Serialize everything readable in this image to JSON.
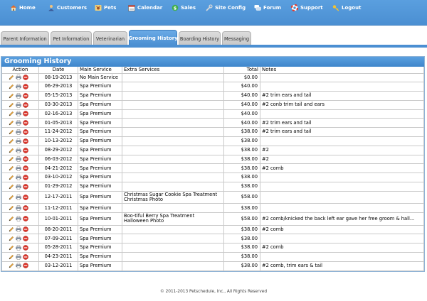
{
  "nav": {
    "items": [
      {
        "label": "Home",
        "icon": "home-icon"
      },
      {
        "label": "Customers",
        "icon": "customers-icon"
      },
      {
        "label": "Pets",
        "icon": "pets-icon"
      },
      {
        "label": "Calendar",
        "icon": "calendar-icon"
      },
      {
        "label": "Sales",
        "icon": "sales-icon"
      },
      {
        "label": "Site Config",
        "icon": "wrench-icon"
      },
      {
        "label": "Forum",
        "icon": "forum-icon"
      },
      {
        "label": "Support",
        "icon": "lifebuoy-icon"
      },
      {
        "label": "Logout",
        "icon": "key-icon"
      }
    ]
  },
  "tabs": [
    {
      "label": "Parent Information"
    },
    {
      "label": "Pet Information"
    },
    {
      "label": "Veterinarian"
    },
    {
      "label": "Grooming History",
      "active": true
    },
    {
      "label": "Boarding History"
    },
    {
      "label": "Messaging"
    }
  ],
  "panel": {
    "title": "Grooming History",
    "columns": {
      "action": "Action",
      "date": "Date",
      "main_service": "Main Service",
      "extra_services": "Extra Services",
      "total": "Total",
      "notes": "Notes"
    },
    "action_icons": [
      "edit-pencil-icon",
      "print-icon",
      "delete-icon"
    ],
    "rows": [
      {
        "date": "08-19-2013",
        "main": "No Main Service",
        "extra": "",
        "total": "$0.00",
        "notes": ""
      },
      {
        "date": "06-29-2013",
        "main": "Spa Premium",
        "extra": "",
        "total": "$40.00",
        "notes": ""
      },
      {
        "date": "05-15-2013",
        "main": "Spa Premium",
        "extra": "",
        "total": "$40.00",
        "notes": "#2 trim ears and tail"
      },
      {
        "date": "03-30-2013",
        "main": "Spa Premium",
        "extra": "",
        "total": "$40.00",
        "notes": "#2 conb trim tail and ears"
      },
      {
        "date": "02-16-2013",
        "main": "Spa Premium",
        "extra": "",
        "total": "$40.00",
        "notes": ""
      },
      {
        "date": "01-05-2013",
        "main": "Spa Premium",
        "extra": "",
        "total": "$40.00",
        "notes": "#2 trim ears and tail"
      },
      {
        "date": "11-24-2012",
        "main": "Spa Premium",
        "extra": "",
        "total": "$38.00",
        "notes": "#2 trim ears and tail"
      },
      {
        "date": "10-13-2012",
        "main": "Spa Premium",
        "extra": "",
        "total": "$38.00",
        "notes": ""
      },
      {
        "date": "08-29-2012",
        "main": "Spa Premium",
        "extra": "",
        "total": "$38.00",
        "notes": "#2"
      },
      {
        "date": "06-03-2012",
        "main": "Spa Premium",
        "extra": "",
        "total": "$38.00",
        "notes": "#2"
      },
      {
        "date": "04-21-2012",
        "main": "Spa Premium",
        "extra": "",
        "total": "$38.00",
        "notes": "#2 comb"
      },
      {
        "date": "03-10-2012",
        "main": "Spa Premium",
        "extra": "",
        "total": "$38.00",
        "notes": ""
      },
      {
        "date": "01-29-2012",
        "main": "Spa Premium",
        "extra": "",
        "total": "$38.00",
        "notes": ""
      },
      {
        "date": "12-17-2011",
        "main": "Spa Premium",
        "extra": "Christmas Sugar Cookie Spa Treatment",
        "extra2": "Christmas Photo",
        "total": "$58.00",
        "notes": ""
      },
      {
        "date": "11-12-2011",
        "main": "Spa Premium",
        "extra": "",
        "total": "$38.00",
        "notes": ""
      },
      {
        "date": "10-01-2011",
        "main": "Spa Premium",
        "extra": "Boo-tiful Berry Spa Treatment",
        "extra2": "Halloween Photo",
        "total": "$58.00",
        "notes": "#2 comb/knicked the back left ear gave her free groom & hall..."
      },
      {
        "date": "08-20-2011",
        "main": "Spa Premium",
        "extra": "",
        "total": "$38.00",
        "notes": "#2 comb"
      },
      {
        "date": "07-09-2011",
        "main": "Spa Premium",
        "extra": "",
        "total": "$38.00",
        "notes": ""
      },
      {
        "date": "05-28-2011",
        "main": "Spa Premium",
        "extra": "",
        "total": "$38.00",
        "notes": "#2 comb"
      },
      {
        "date": "04-23-2011",
        "main": "Spa Premium",
        "extra": "",
        "total": "$38.00",
        "notes": ""
      },
      {
        "date": "03-12-2011",
        "main": "Spa Premium",
        "extra": "",
        "total": "$38.00",
        "notes": "#2 comb, trim ears & tail"
      }
    ]
  },
  "footer": {
    "text": "© 2011-2013 Petschedule, Inc., All Rights Reserved"
  },
  "colors": {
    "nav_blue": "#4b8fd2",
    "panel_title": "#3f86cb",
    "delete_red": "#d9352b"
  }
}
